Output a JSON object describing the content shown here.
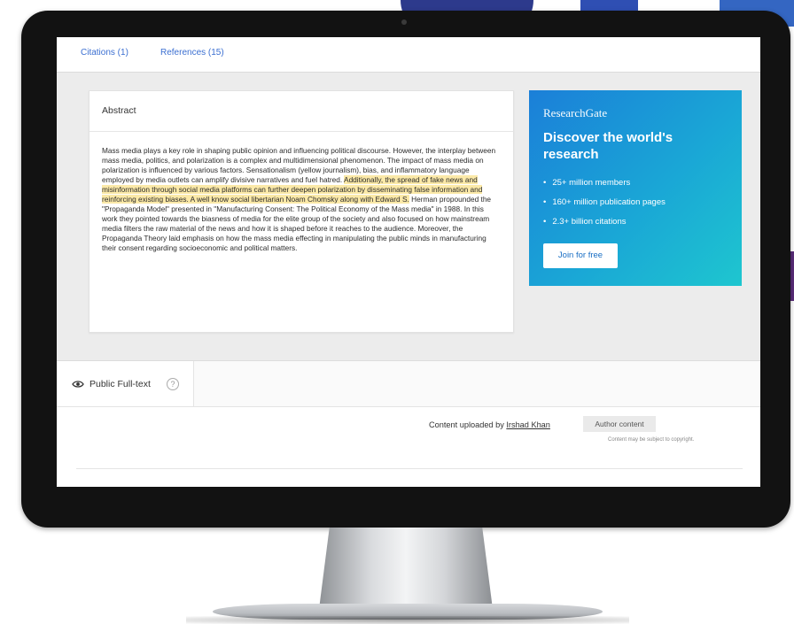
{
  "nav": {
    "citations": "Citations (1)",
    "references": "References (15)"
  },
  "abstract": {
    "heading": "Abstract",
    "text_before": "Mass media plays a key role in shaping public opinion and influencing political discourse. However, the interplay between mass media, politics, and polarization is a complex and multidimensional phenomenon. The impact of mass media on polarization is influenced by various factors. Sensationalism (yellow journalism), bias, and inflammatory language employed by media outlets can amplify divisive narratives and fuel hatred. ",
    "text_highlight": "Additionally, the spread of fake news and misinformation through social media platforms can further deepen polarization by disseminating false information and reinforcing existing biases. A well know social libertarian Noam Chomsky along with Edward S.",
    "text_after": " Herman propounded the \"Propaganda Model\" presented in \"Manufacturing Consent: The Political Economy of the Mass media\" in 1988. In this work they pointed towards the biasness of media for the elite group of the society and also focused on how mainstream media filters the raw material of the news and how it is shaped before it reaches to the audience. Moreover, the Propaganda Theory laid emphasis on how the mass media effecting in manipulating the public minds in manufacturing their consent regarding socioeconomic and political matters.",
    "highlight_color": "#fbe9a8"
  },
  "ad": {
    "logo": "ResearchGate",
    "title": "Discover the world's research",
    "bullets": [
      "25+ million members",
      "160+ million publication pages",
      "2.3+ billion citations"
    ],
    "button": "Join for free",
    "gradient_start": "#1b7fd8",
    "gradient_end": "#1ec6cf"
  },
  "fulltext": {
    "tab_label": "Public Full-text",
    "tab_icon": "eye-icon",
    "help_icon": "question-icon",
    "help_glyph": "?",
    "uploaded_prefix": "Content uploaded by",
    "uploaded_by": "Irshad Khan",
    "badge": "Author content",
    "note": "Content may be subject to copyright."
  }
}
